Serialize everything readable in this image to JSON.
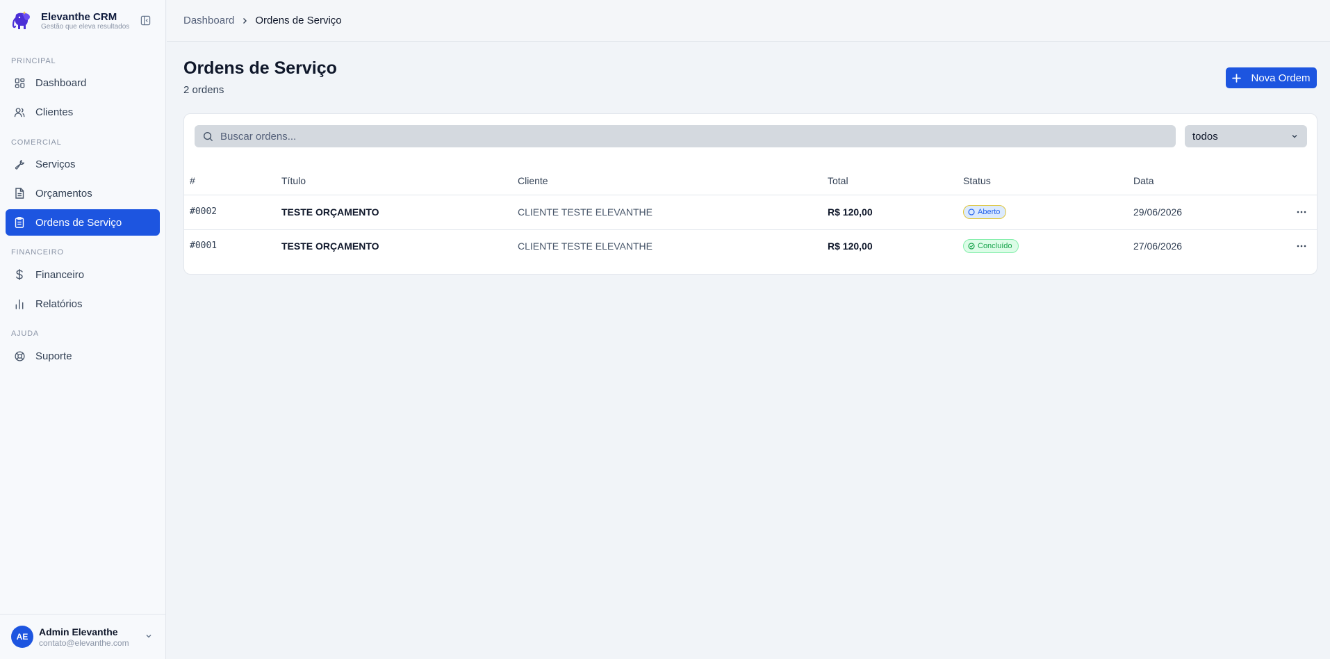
{
  "brand": {
    "name": "Elevanthe CRM",
    "tagline": "Gestão que eleva resultados"
  },
  "sidebar": {
    "sections": [
      {
        "label": "PRINCIPAL",
        "items": [
          {
            "label": "Dashboard",
            "icon": "layout-grid-icon"
          },
          {
            "label": "Clientes",
            "icon": "users-icon"
          }
        ]
      },
      {
        "label": "COMERCIAL",
        "items": [
          {
            "label": "Serviços",
            "icon": "wrench-icon"
          },
          {
            "label": "Orçamentos",
            "icon": "file-text-icon"
          },
          {
            "label": "Ordens de Serviço",
            "icon": "clipboard-icon",
            "active": true
          }
        ]
      },
      {
        "label": "FINANCEIRO",
        "items": [
          {
            "label": "Financeiro",
            "icon": "dollar-icon"
          },
          {
            "label": "Relatórios",
            "icon": "bar-chart-icon"
          }
        ]
      },
      {
        "label": "AJUDA",
        "items": [
          {
            "label": "Suporte",
            "icon": "life-buoy-icon"
          }
        ]
      }
    ]
  },
  "user": {
    "initials": "AE",
    "name": "Admin Elevanthe",
    "email": "contato@elevanthe.com"
  },
  "breadcrumb": {
    "parent": "Dashboard",
    "current": "Ordens de Serviço"
  },
  "page": {
    "title": "Ordens de Serviço",
    "subtitle": "2 ordens",
    "new_button": "Nova Ordem"
  },
  "filters": {
    "search_placeholder": "Buscar ordens...",
    "status_value": "todos"
  },
  "table": {
    "columns": [
      "#",
      "Título",
      "Cliente",
      "Total",
      "Status",
      "Data"
    ],
    "rows": [
      {
        "number": "#0002",
        "title": "TESTE ORÇAMENTO",
        "client": "CLIENTE TESTE ELEVANTHE",
        "total": "R$ 120,00",
        "status": "Aberto",
        "date": "29/06/2026"
      },
      {
        "number": "#0001",
        "title": "TESTE ORÇAMENTO",
        "client": "CLIENTE TESTE ELEVANTHE",
        "total": "R$ 120,00",
        "status": "Concluído",
        "date": "27/06/2026"
      }
    ]
  },
  "colors": {
    "primary": "#1d55e0",
    "status_open": "#2563eb",
    "status_done": "#16a34a"
  }
}
